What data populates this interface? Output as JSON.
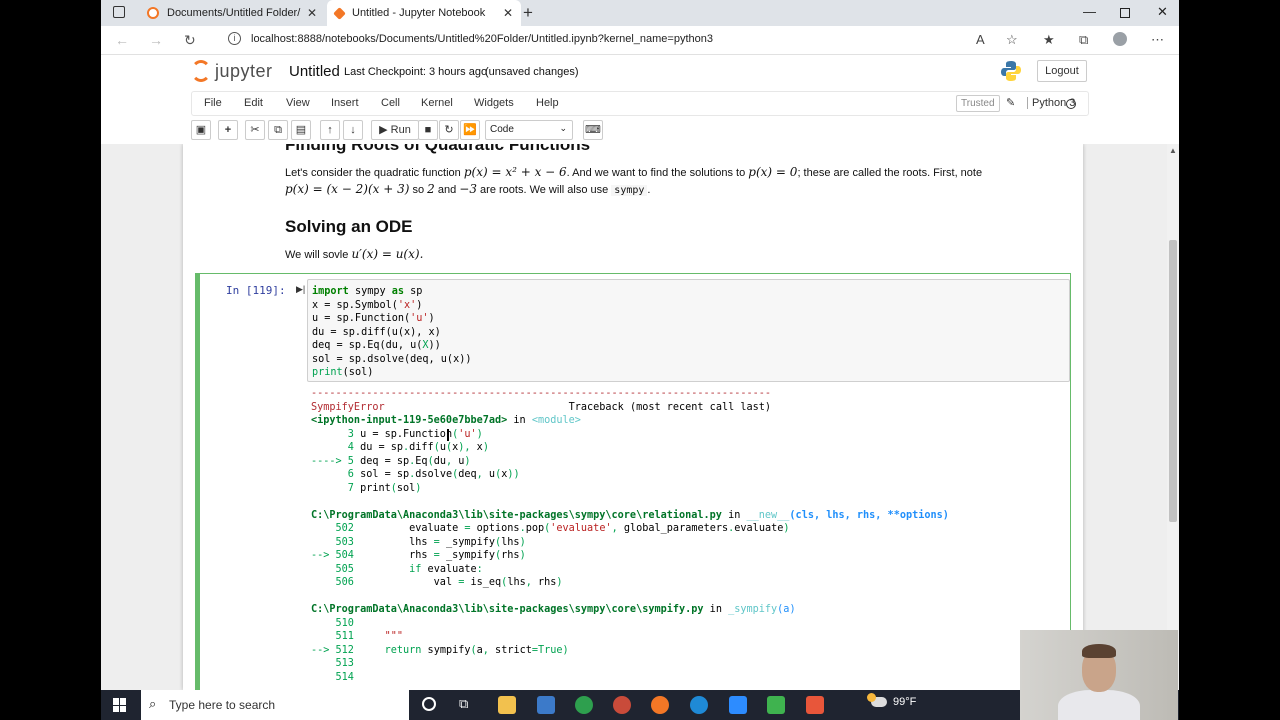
{
  "browser": {
    "tabs": [
      {
        "label": "Documents/Untitled Folder/",
        "active": false
      },
      {
        "label": "Untitled - Jupyter Notebook",
        "active": true
      }
    ],
    "new_tab": "+",
    "url": "localhost:8888/notebooks/Documents/Untitled%20Folder/Untitled.ipynb?kernel_name=python3"
  },
  "jupyter": {
    "logo_text": "jupyter",
    "notebook_title": "Untitled",
    "checkpoint": "Last Checkpoint: 3 hours ago",
    "unsaved": "(unsaved changes)",
    "logout": "Logout",
    "menu": [
      "File",
      "Edit",
      "View",
      "Insert",
      "Cell",
      "Kernel",
      "Widgets",
      "Help"
    ],
    "trusted": "Trusted",
    "kernel_name": "Python 3",
    "toolbar": {
      "run_label": "Run",
      "cell_type": "Code"
    }
  },
  "notebook": {
    "heading1": "Finding Roots of Quadratic Functions",
    "para1_a": "Let's consider the quadratic function",
    "para1_math1": "p(x) = x² + x − 6",
    "para1_b": ". And we want to find the solutions to",
    "para1_math2": "p(x) = 0",
    "para1_c": "; these are called the roots. First, note",
    "para1_math3": "p(x) = (x − 2)(x + 3)",
    "para1_d": "so",
    "para1_math4": "2",
    "para1_e": "and",
    "para1_math5": "−3",
    "para1_f": "are roots. We will also use",
    "para1_code": "sympy",
    "para1_g": ".",
    "heading2": "Solving an ODE",
    "para2_a": "We will sovle",
    "para2_math": "u′(x) = u(x).",
    "cell_prompt": "In [119]:"
  },
  "taskbar": {
    "search_placeholder": "Type here to search",
    "weather": "99°F"
  }
}
